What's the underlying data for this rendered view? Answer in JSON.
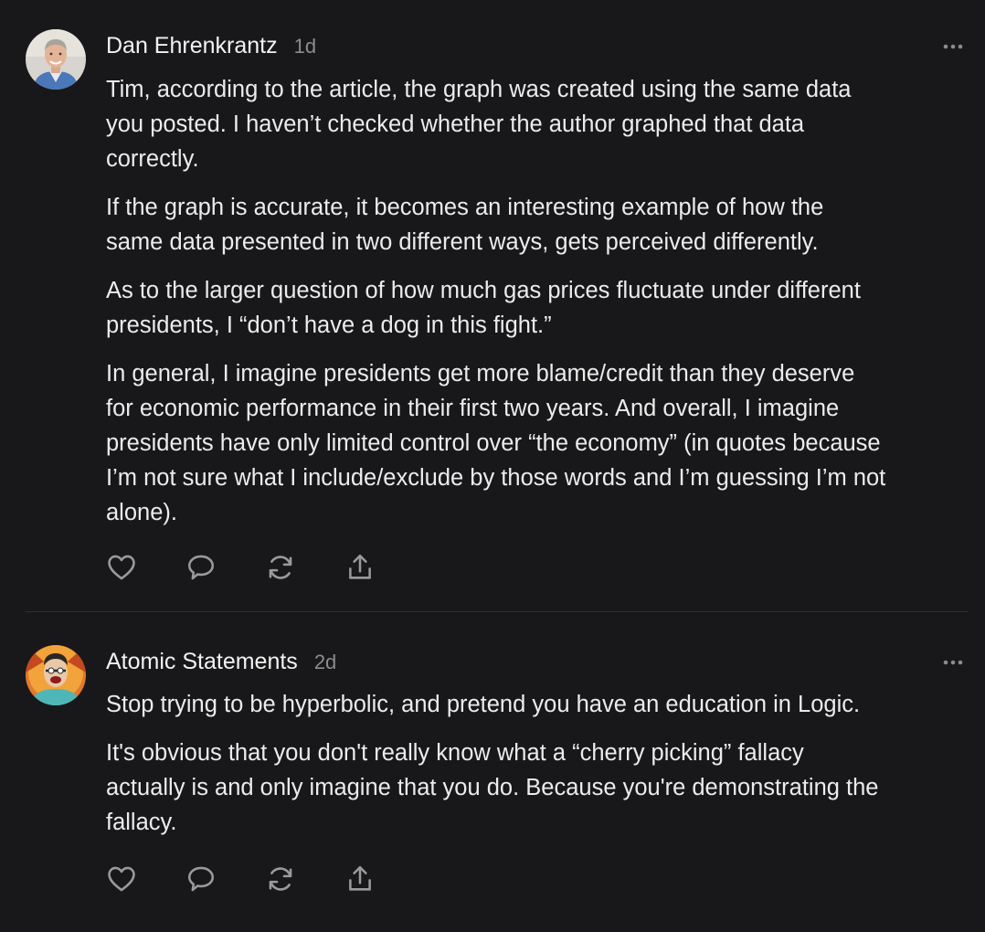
{
  "comments": [
    {
      "author": "Dan Ehrenkrantz",
      "age": "1d",
      "avatar": "avatar-photo",
      "paragraphs": [
        [
          "Tim, according to the article, the graph was created using the same data",
          "you posted. I haven’t checked whether the author graphed that data",
          "correctly."
        ],
        [
          "If the graph is accurate, it becomes an interesting example of how the",
          "same data presented in two different ways, gets perceived differently."
        ],
        [
          "As to the larger question of how much gas prices fluctuate under different",
          "presidents, I “don’t have a dog in this fight.”"
        ],
        [
          "In general, I imagine presidents get more blame/credit than they deserve",
          "for economic performance in their first two years. And overall, I imagine",
          "presidents have only limited control over “the economy” (in quotes because",
          "I’m not sure what I include/exclude by those words and I’m guessing I’m not",
          "alone)."
        ]
      ],
      "actions": [
        "heart-icon",
        "comment-icon",
        "restack-icon",
        "share-icon"
      ]
    },
    {
      "author": "Atomic Statements",
      "age": "2d",
      "avatar": "avatar-illustration",
      "paragraphs": [
        [
          "Stop trying to be hyperbolic, and pretend you have an education in Logic."
        ],
        [
          "It's obvious that you don't really know what a “cherry picking” fallacy",
          "actually is and only imagine that you do. Because you're demonstrating the",
          "fallacy."
        ]
      ],
      "actions": [
        "heart-icon",
        "comment-icon",
        "restack-icon",
        "share-icon"
      ]
    }
  ],
  "colors": {
    "background": "#18181a",
    "text": "#ececec",
    "muted": "#8c8c8e",
    "divider": "#2f2f31",
    "icon": "#9a9a9c"
  }
}
